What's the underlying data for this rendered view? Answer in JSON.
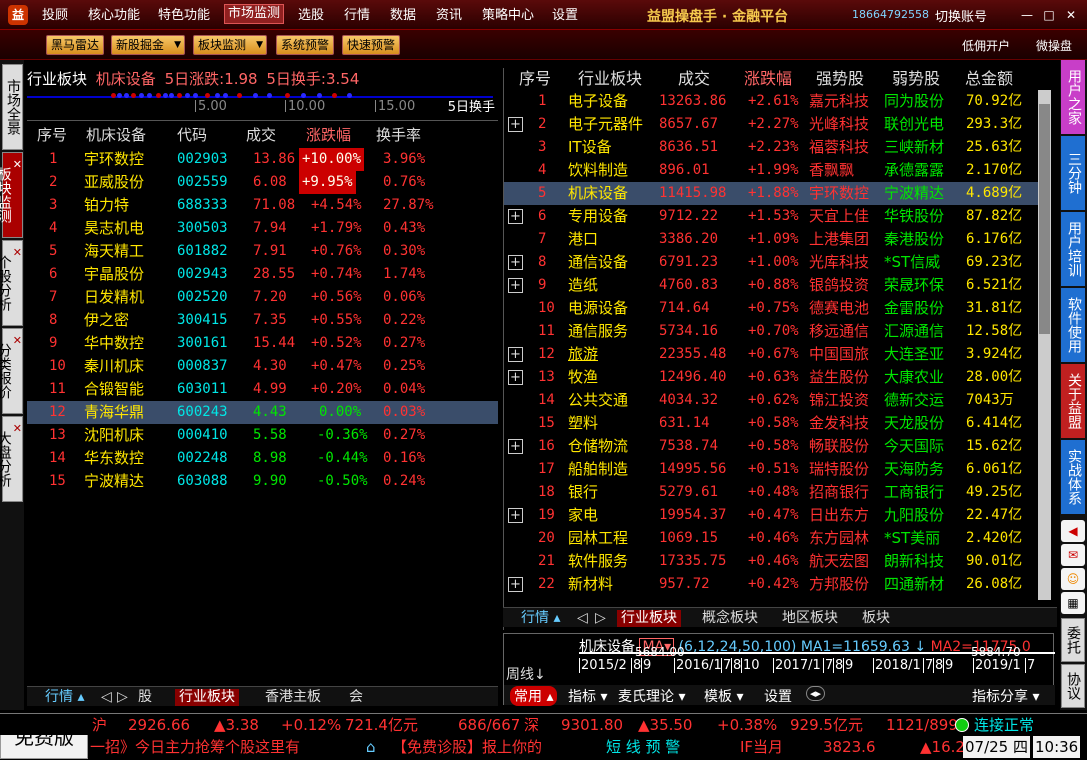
{
  "menu": {
    "items": [
      "投顾",
      "核心功能",
      "特色功能",
      "市场监测",
      "选股",
      "行情",
      "数据",
      "资讯",
      "策略中心",
      "设置"
    ],
    "app_title": "益盟操盘手 · 金融平台",
    "phone": "18664792558",
    "switch_account": "切换账号"
  },
  "toolbar": {
    "buttons": [
      "黑马雷达",
      "新股掘金",
      "板块监测",
      "系统预警",
      "快速预警"
    ],
    "right": [
      "低佣开户",
      "微操盘"
    ]
  },
  "left_tabs": [
    "市场全景",
    "板块监测",
    "个股分析",
    "分类报价",
    "大盘分析"
  ],
  "right_tabs": [
    "用户之家",
    "三分钟",
    "用户培训",
    "软件使用",
    "关于益盟",
    "实战体系",
    "委托",
    "协议"
  ],
  "left": {
    "header": {
      "name": "行业板块",
      "sector": "机床设备",
      "change5": "5日涨跌:1.98",
      "turn5": "5日换手:3.54"
    },
    "scale": {
      "ticks": [
        "5.00",
        "10.00",
        "15.00"
      ],
      "button": "5日换手"
    },
    "columns": [
      "序号",
      "机床设备",
      "代码",
      "成交",
      "涨跌幅",
      "换手率"
    ],
    "rows": [
      [
        "1",
        "宇环数控",
        "002903",
        "13.86",
        "+10.00%",
        "3.96%"
      ],
      [
        "2",
        "亚威股份",
        "002559",
        "6.08",
        "+9.95%",
        "0.76%"
      ],
      [
        "3",
        "铂力特",
        "688333",
        "71.08",
        "+4.54%",
        "27.87%"
      ],
      [
        "4",
        "昊志机电",
        "300503",
        "7.94",
        "+1.79%",
        "0.43%"
      ],
      [
        "5",
        "海天精工",
        "601882",
        "7.91",
        "+0.76%",
        "0.30%"
      ],
      [
        "6",
        "宇晶股份",
        "002943",
        "28.55",
        "+0.74%",
        "1.74%"
      ],
      [
        "7",
        "日发精机",
        "002520",
        "7.20",
        "+0.56%",
        "0.06%"
      ],
      [
        "8",
        "伊之密",
        "300415",
        "7.35",
        "+0.55%",
        "0.22%"
      ],
      [
        "9",
        "华中数控",
        "300161",
        "15.44",
        "+0.52%",
        "0.27%"
      ],
      [
        "10",
        "秦川机床",
        "000837",
        "4.30",
        "+0.47%",
        "0.25%"
      ],
      [
        "11",
        "合锻智能",
        "603011",
        "4.99",
        "+0.20%",
        "0.04%"
      ],
      [
        "12",
        "青海华鼎",
        "600243",
        "4.43",
        "0.00%",
        "0.03%"
      ],
      [
        "13",
        "沈阳机床",
        "000410",
        "5.58",
        "-0.36%",
        "0.27%"
      ],
      [
        "14",
        "华东数控",
        "002248",
        "8.98",
        "-0.44%",
        "0.16%"
      ],
      [
        "15",
        "宁波精达",
        "603088",
        "9.90",
        "-0.50%",
        "0.24%"
      ]
    ],
    "bottom_tabs": [
      "行情",
      "股",
      "行业板块",
      "香港主板",
      "会"
    ]
  },
  "right": {
    "columns": [
      "序号",
      "行业板块",
      "成交",
      "涨跌幅",
      "强势股",
      "弱势股",
      "总金额"
    ],
    "rows": [
      [
        "1",
        "电子设备",
        "13263.86",
        "+2.61%",
        "嘉元科技",
        "同为股份",
        "70.92亿"
      ],
      [
        "2",
        "电子元器件",
        "8657.67",
        "+2.27%",
        "光峰科技",
        "联创光电",
        "293.3亿"
      ],
      [
        "3",
        "IT设备",
        "8636.51",
        "+2.23%",
        "福蓉科技",
        "三峡新材",
        "25.63亿"
      ],
      [
        "4",
        "饮料制造",
        "896.01",
        "+1.99%",
        "香飘飘",
        "承德露露",
        "2.170亿"
      ],
      [
        "5",
        "机床设备",
        "11415.98",
        "+1.88%",
        "宇环数控",
        "宁波精达",
        "4.689亿"
      ],
      [
        "6",
        "专用设备",
        "9712.22",
        "+1.53%",
        "天宜上佳",
        "华铁股份",
        "87.82亿"
      ],
      [
        "7",
        "港口",
        "3386.20",
        "+1.09%",
        "上港集团",
        "秦港股份",
        "6.176亿"
      ],
      [
        "8",
        "通信设备",
        "6791.23",
        "+1.00%",
        "光库科技",
        "*ST信威",
        "69.23亿"
      ],
      [
        "9",
        "造纸",
        "4760.83",
        "+0.88%",
        "银鸽投资",
        "荣晟环保",
        "6.521亿"
      ],
      [
        "10",
        "电源设备",
        "714.64",
        "+0.75%",
        "德赛电池",
        "金雷股份",
        "31.81亿"
      ],
      [
        "11",
        "通信服务",
        "5734.16",
        "+0.70%",
        "移远通信",
        "汇源通信",
        "12.58亿"
      ],
      [
        "12",
        "旅游",
        "22355.48",
        "+0.67%",
        "中国国旅",
        "大连圣亚",
        "3.924亿"
      ],
      [
        "13",
        "牧渔",
        "12496.40",
        "+0.63%",
        "益生股份",
        "大康农业",
        "28.00亿"
      ],
      [
        "14",
        "公共交通",
        "4034.32",
        "+0.62%",
        "锦江投资",
        "德新交运",
        "7043万"
      ],
      [
        "15",
        "塑料",
        "631.14",
        "+0.58%",
        "金发科技",
        "天龙股份",
        "6.414亿"
      ],
      [
        "16",
        "仓储物流",
        "7538.74",
        "+0.58%",
        "畅联股份",
        "今天国际",
        "15.62亿"
      ],
      [
        "17",
        "船舶制造",
        "14995.56",
        "+0.51%",
        "瑞特股份",
        "天海防务",
        "6.061亿"
      ],
      [
        "18",
        "银行",
        "5279.61",
        "+0.48%",
        "招商银行",
        "工商银行",
        "49.25亿"
      ],
      [
        "19",
        "家电",
        "19954.37",
        "+0.47%",
        "日出东方",
        "九阳股份",
        "22.47亿"
      ],
      [
        "20",
        "园林工程",
        "1069.15",
        "+0.46%",
        "东方园林",
        "*ST美丽",
        "2.420亿"
      ],
      [
        "21",
        "软件服务",
        "17335.75",
        "+0.46%",
        "航天宏图",
        "朗新科技",
        "90.01亿"
      ],
      [
        "22",
        "新材料",
        "957.72",
        "+0.42%",
        "方邦股份",
        "四通新材",
        "26.08亿"
      ]
    ],
    "plus_rows": [
      1,
      5,
      7,
      8,
      11,
      12,
      15,
      18,
      21
    ],
    "bottom_tabs": [
      "行情",
      "行业板块",
      "概念板块",
      "地区板块",
      "板块"
    ]
  },
  "kline": {
    "title": "机床设备",
    "ma_label": "MA",
    "params": "(6,12,24,50,100)",
    "ma1": "MA1=11659.63",
    "ma2": "MA2=11775.0",
    "period": "周线",
    "top_val_left": "5684.00",
    "top_val_right": "5884.70",
    "dates": [
      "2015/2",
      "8",
      "9",
      "2016/1",
      "7",
      "8",
      "10",
      "2017/1",
      "7",
      "8",
      "9",
      "2018/1",
      "7",
      "8",
      "9",
      "2019/1",
      "7"
    ],
    "menu": [
      "常用",
      "指标",
      "麦氏理论",
      "模板",
      "设置",
      "指标分享"
    ]
  },
  "status": {
    "free": "免费版",
    "sh_label": "沪",
    "sh_index": "2926.66",
    "sh_change": "▲3.38",
    "sh_pct": "+0.12%",
    "sh_amount": "721.4亿元",
    "sh_updown": "686/667",
    "sz_label": "深",
    "sz_index": "9301.80",
    "sz_change": "▲35.50",
    "sz_pct": "+0.38%",
    "sz_amount": "929.5亿元",
    "sz_updown": "1121/899",
    "connection": "连接正常",
    "ticker1": "一招》今日主力抢筹个股这里有",
    "ticker2": "【免费诊股】报上你的",
    "ticker3": "短 线 预 警",
    "if_label": "IF当月",
    "if_value": "3823.6",
    "if_change": "▲16.2",
    "date": "07/25 四",
    "time": "10:36"
  }
}
